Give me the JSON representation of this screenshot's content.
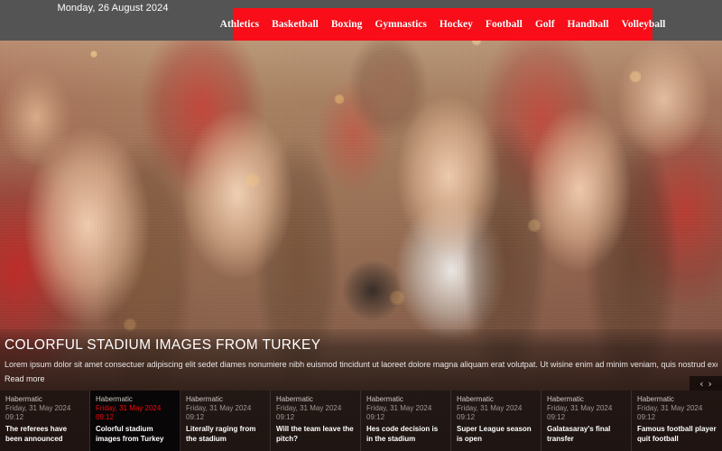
{
  "header": {
    "date": "Monday, 26 August 2024",
    "nav": [
      {
        "label": "Athletics"
      },
      {
        "label": "Basketball"
      },
      {
        "label": "Boxing"
      },
      {
        "label": "Gymnastics"
      },
      {
        "label": "Hockey"
      },
      {
        "label": "Football"
      },
      {
        "label": "Golf"
      },
      {
        "label": "Handball"
      },
      {
        "label": "Volleyball"
      }
    ],
    "nav_background": "#f90d18",
    "bar_background": "#545454"
  },
  "hero": {
    "title": "COLORFUL STADIUM IMAGES FROM TURKEY",
    "description": "Lorem ipsum dolor sit amet consectuer adipiscing elit sedet diames nonumiere nibh euismod tincidunt ut laoreet dolore magna aliquam erat volutpat. Ut wisine enim ad minim veniam, quis nostrud exerci t...",
    "read_more": "Read more",
    "image_alt": "Crowd of sports fans cheering in red jerseys with megaphone"
  },
  "carousel": {
    "prev_label": "‹",
    "next_label": "›"
  },
  "thumbnails": [
    {
      "source": "Habermatic",
      "date": "Friday, 31 May 2024",
      "time": "09:12",
      "headline": "The referees have been announced",
      "active": false
    },
    {
      "source": "Habermatic",
      "date": "Friday, 31 May 2024",
      "time": "09:12",
      "headline": "Colorful stadium images from Turkey",
      "active": true
    },
    {
      "source": "Habermatic",
      "date": "Friday, 31 May 2024",
      "time": "09:12",
      "headline": "Literally raging from the stadium",
      "active": false
    },
    {
      "source": "Habermatic",
      "date": "Friday, 31 May 2024",
      "time": "09:12",
      "headline": "Will the team leave the pitch?",
      "active": false
    },
    {
      "source": "Habermatic",
      "date": "Friday, 31 May 2024",
      "time": "09:12",
      "headline": "Hes code decision is in the stadium",
      "active": false
    },
    {
      "source": "Habermatic",
      "date": "Friday, 31 May 2024",
      "time": "09:12",
      "headline": "Super League season is open",
      "active": false
    },
    {
      "source": "Habermatic",
      "date": "Friday, 31 May 2024",
      "time": "09:12",
      "headline": "Galatasaray's final transfer",
      "active": false
    },
    {
      "source": "Habermatic",
      "date": "Friday, 31 May 2024",
      "time": "09:12",
      "headline": "Famous football player quit football",
      "active": false
    }
  ]
}
